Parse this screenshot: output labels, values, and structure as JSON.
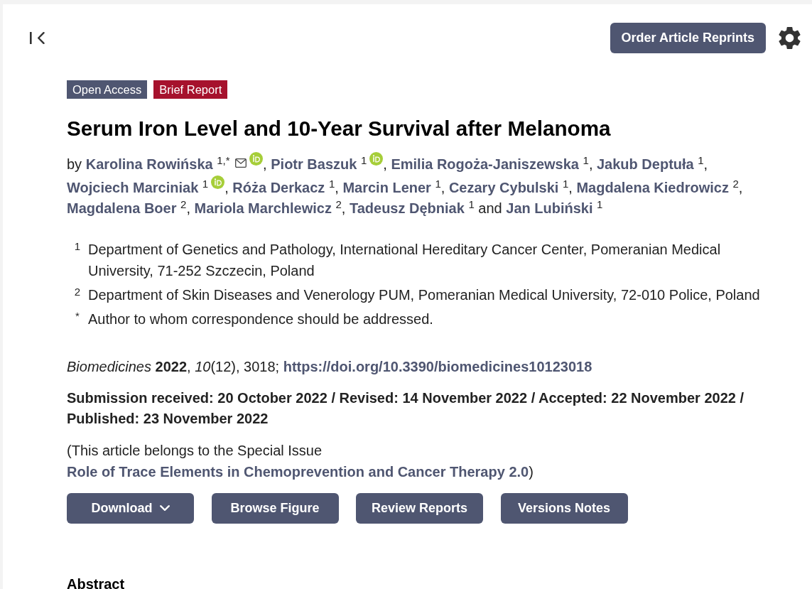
{
  "toolbar": {
    "reprints_button": "Order Article Reprints"
  },
  "tags": [
    {
      "label": "Open Access",
      "color": "#4f5671"
    },
    {
      "label": "Brief Report",
      "color": "#a6122d"
    }
  ],
  "title": "Serum Iron Level and 10-Year Survival after Melanoma",
  "byline": {
    "lead": "by",
    "joiner": "and",
    "authors": [
      {
        "name": "Karolina Rowińska",
        "affiliation": "1,*",
        "email": true,
        "orcid": true,
        "trail": ","
      },
      {
        "name": "Piotr Baszuk",
        "affiliation": "1",
        "email": false,
        "orcid": true,
        "trail": ","
      },
      {
        "name": "Emilia Rogoża-Janiszewska",
        "affiliation": "1",
        "email": false,
        "orcid": false,
        "trail": ","
      },
      {
        "name": "Jakub Deptuła",
        "affiliation": "1",
        "email": false,
        "orcid": false,
        "trail": ","
      },
      {
        "name": "Wojciech Marciniak",
        "affiliation": "1",
        "email": false,
        "orcid": true,
        "trail": ","
      },
      {
        "name": "Róża Derkacz",
        "affiliation": "1",
        "email": false,
        "orcid": false,
        "trail": ","
      },
      {
        "name": "Marcin Lener",
        "affiliation": "1",
        "email": false,
        "orcid": false,
        "trail": ","
      },
      {
        "name": "Cezary Cybulski",
        "affiliation": "1",
        "email": false,
        "orcid": false,
        "trail": ","
      },
      {
        "name": "Magdalena Kiedrowicz",
        "affiliation": "2",
        "email": false,
        "orcid": false,
        "trail": ","
      },
      {
        "name": "Magdalena Boer",
        "affiliation": "2",
        "email": false,
        "orcid": false,
        "trail": ","
      },
      {
        "name": "Mariola Marchlewicz",
        "affiliation": "2",
        "email": false,
        "orcid": false,
        "trail": ","
      },
      {
        "name": "Tadeusz Dębniak",
        "affiliation": "1",
        "email": false,
        "orcid": false
      },
      {
        "name": "Jan Lubiński",
        "affiliation": "1",
        "email": false,
        "orcid": false
      }
    ]
  },
  "affiliations": [
    {
      "mark": "1",
      "text": "Department of Genetics and Pathology, International Hereditary Cancer Center, Pomeranian Medical University, 71-252 Szczecin, Poland"
    },
    {
      "mark": "2",
      "text": "Department of Skin Diseases and Venerology PUM, Pomeranian Medical University, 72-010 Police, Poland"
    },
    {
      "mark": "*",
      "text": "Author to whom correspondence should be addressed."
    }
  ],
  "citation": {
    "text": "*Biomedicines* **2022**, *10*(12), 3018;",
    "doi": "https://doi.org/10.3390/biomedicines10123018"
  },
  "dates": "Submission received: 20 October 2022 / Revised: 14 November 2022 / Accepted: 22 November 2022 / Published: 23 November 2022",
  "special_issue": {
    "before": "(This article belongs to the Special Issue",
    "link": "Role of Trace Elements in Chemoprevention and Cancer Therapy 2.0",
    "after": ")"
  },
  "actions": [
    {
      "label": "Download",
      "kind": "dropdown"
    },
    {
      "label": "Browse Figure",
      "kind": "button"
    },
    {
      "label": "Review Reports",
      "kind": "button"
    },
    {
      "label": "Versions Notes",
      "kind": "button"
    }
  ],
  "abstract_heading": "Abstract"
}
